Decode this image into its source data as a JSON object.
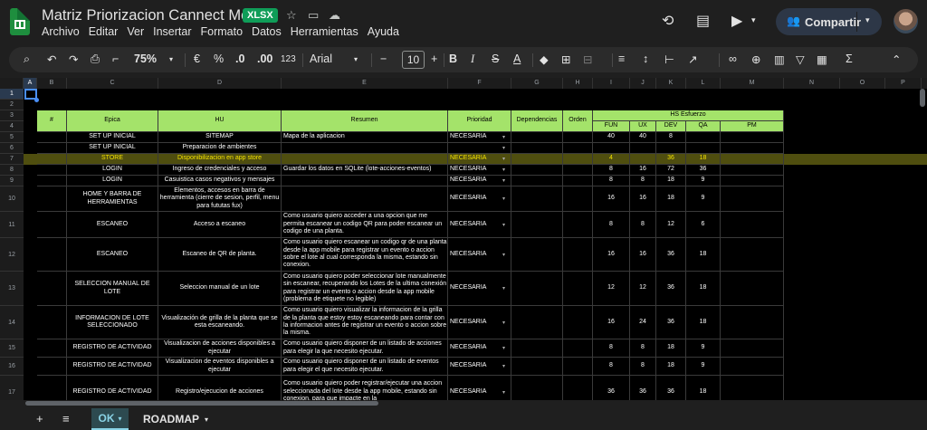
{
  "header": {
    "title": "Matriz Priorizacion Cannect Mobile",
    "badge": "XLSX",
    "menu": [
      "Archivo",
      "Editar",
      "Ver",
      "Insertar",
      "Formato",
      "Datos",
      "Herramientas",
      "Ayuda"
    ],
    "share_label": "Compartir"
  },
  "toolbar": {
    "zoom": "75%",
    "currency": "€",
    "percent": "%",
    "dec_less": ".0",
    "dec_more": ".00",
    "num_format": "123",
    "font": "Arial",
    "font_size": "10"
  },
  "columns": [
    "A",
    "B",
    "C",
    "D",
    "E",
    "F",
    "G",
    "H",
    "I",
    "J",
    "K",
    "L",
    "M",
    "N",
    "O",
    "P"
  ],
  "rows": [
    "1",
    "2",
    "3",
    "4",
    "5",
    "6",
    "7",
    "8",
    "9",
    "10",
    "11",
    "12",
    "13",
    "14",
    "15",
    "16",
    "17"
  ],
  "table_header": {
    "num": "#",
    "epica": "Epica",
    "hu": "HU",
    "resumen": "Resumen",
    "prioridad": "Prioridad",
    "dependencias": "Dependencias",
    "orden": "Orden",
    "hs": "HS Esfuerzo",
    "fun": "FUN",
    "ux": "UX",
    "dev": "DEV",
    "qa": "QA",
    "pm": "PM"
  },
  "table_rows": [
    {
      "epica": "SET UP INICIAL",
      "hu": "SITEMAP",
      "resumen": "Mapa de la aplicacion",
      "prioridad": "NECESARIA",
      "fun": "40",
      "ux": "40",
      "dev": "8",
      "qa": ""
    },
    {
      "epica": "SET UP INICIAL",
      "hu": "Preparacion de ambientes",
      "resumen": "",
      "prioridad": "",
      "fun": "",
      "ux": "",
      "dev": "",
      "qa": ""
    },
    {
      "epica": "STORE",
      "hu": "Disponibilizacion en app store",
      "resumen": "",
      "prioridad": "NECESARIA",
      "fun": "4",
      "ux": "",
      "dev": "36",
      "qa": "18"
    },
    {
      "epica": "LOGIN",
      "hu": "Ingreso de credenciales y acceso",
      "resumen": "Guardar los datos en SQLite (lote-acciones-eventos)",
      "prioridad": "NECESARIA",
      "fun": "8",
      "ux": "16",
      "dev": "72",
      "qa": "36"
    },
    {
      "epica": "LOGIN",
      "hu": "Casuistica casos negativos y mensajes",
      "resumen": "",
      "prioridad": "NECESARIA",
      "fun": "8",
      "ux": "8",
      "dev": "18",
      "qa": "9"
    },
    {
      "epica": "HOME Y BARRA DE HERRAMIENTAS",
      "hu": "Elementos, accesos en barra de herramienta (cierre de sesion, perfil, menu para fututas fux)",
      "resumen": "",
      "prioridad": "NECESARIA",
      "fun": "16",
      "ux": "16",
      "dev": "18",
      "qa": "9"
    },
    {
      "epica": "ESCANEO",
      "hu": "Acceso a escaneo",
      "resumen": "Como usuario quiero acceder a una opcion que me permita escanear un codigo QR para poder escanear un codigo de una planta.",
      "prioridad": "NECESARIA",
      "fun": "8",
      "ux": "8",
      "dev": "12",
      "qa": "6"
    },
    {
      "epica": "ESCANEO",
      "hu": "Escaneo de QR de planta.",
      "resumen": "Como usuario quiero escanear un codigo qr de una planta desde la app mobile para registrar un evento o accion sobre el lote al cual corresponda la misma, estando sin conexion.",
      "prioridad": "NECESARIA",
      "fun": "16",
      "ux": "16",
      "dev": "36",
      "qa": "18"
    },
    {
      "epica": "SELECCION MANUAL DE LOTE",
      "hu": "Seleccion manual de un lote",
      "resumen": "Como usuario quiero poder seleccionar lote manualmente sin escanear, recuperando los Lotes de la ultima conexión para registrar un evento o accion desde la app mobile (problema de etiquete no legible)",
      "prioridad": "NECESARIA",
      "fun": "12",
      "ux": "12",
      "dev": "36",
      "qa": "18"
    },
    {
      "epica": "INFORMACION DE LOTE SELECCIONADO",
      "hu": "Visualización de grilla de la planta que se esta escaneando.",
      "resumen": "Como usuario quiero visualizar la informacion de la grilla de la planta que estoy estoy escaneando para contar con la informacion antes de registrar un evento o accion sobre la misma.",
      "prioridad": "NECESARIA",
      "fun": "16",
      "ux": "24",
      "dev": "36",
      "qa": "18"
    },
    {
      "epica": "REGISTRO DE ACTIVIDAD",
      "hu": "Visualizacion de acciones disponibles a ejecutar",
      "resumen": "Como usuario quiero disponer de un listado de acciones para elegir la que necesito ejecutar.",
      "prioridad": "NECESARIA",
      "fun": "8",
      "ux": "8",
      "dev": "18",
      "qa": "9"
    },
    {
      "epica": "REGISTRO DE ACTIVIDAD",
      "hu": "Visualizacion de eventos disponibles a ejecutar",
      "resumen": "Como usuario quiero disponer de un listado de eventos para elegir el que necesito ejecutar.",
      "prioridad": "NECESARIA",
      "fun": "8",
      "ux": "8",
      "dev": "18",
      "qa": "9"
    },
    {
      "epica": "REGISTRO DE ACTIVIDAD",
      "hu": "Registro/ejecucion de acciones",
      "resumen": "Como usuario quiero poder registrar/ejecutar una accion seleccionada del lote desde la app mobile, estando sin conexion, para que impacte en la",
      "prioridad": "NECESARIA",
      "fun": "36",
      "ux": "36",
      "dev": "36",
      "qa": "18"
    }
  ],
  "tabs": {
    "ok": "OK",
    "roadmap": "ROADMAP"
  },
  "colors": {
    "header_green": "#a4e36a",
    "selected_row": "#4f4e0f",
    "selected_text": "#f4e100"
  }
}
